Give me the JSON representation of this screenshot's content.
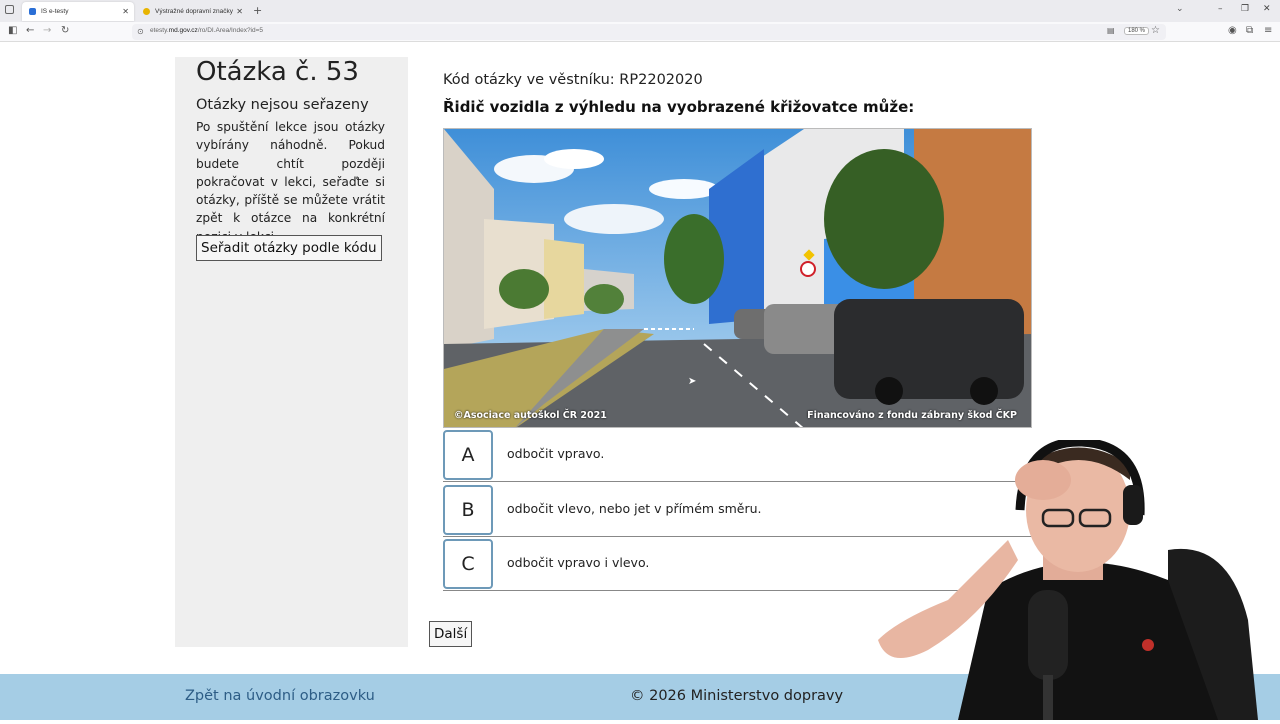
{
  "browser": {
    "tabs": [
      {
        "title": "IS e-testy",
        "active": true
      },
      {
        "title": "Výstražné dopravní značky",
        "active": false
      }
    ],
    "url_prefix": "etesty.",
    "url_domain": "md.gov.cz",
    "url_path": "/ro/DI.Area/Index?id=5",
    "zoom": "180 %"
  },
  "sidebar": {
    "question_number": "Otázka č. 53",
    "heading": "Otázky nejsou seřazeny",
    "paragraph": "Po spuštění lekce jsou otázky vybírány náhodně. Pokud budete chtít později pokračovat v lekci, seřaďte si otázky, příště se můžete vrátit zpět k otázce na konkrétní pozici v lekci.",
    "sort_button": "Seřadit otázky podle kódu"
  },
  "main": {
    "code_line": "Kód otázky ve věstníku: RP2202020",
    "question": "Řidič vozidla z výhledu na vyobrazené křižovatce může:",
    "photo_caption_left": "©Asociace autoškol ČR 2021",
    "photo_caption_right": "Financováno z fondu zábrany škod ČKP",
    "answers": [
      {
        "letter": "A",
        "text": "odbočit vpravo."
      },
      {
        "letter": "B",
        "text": "odbočit vlevo, nebo jet v přímém směru."
      },
      {
        "letter": "C",
        "text": "odbočit vpravo i vlevo."
      }
    ],
    "next_button": "Další"
  },
  "footer": {
    "back_link": "Zpět na úvodní obrazovku",
    "copyright": "© 2026 Ministerstvo dopravy"
  },
  "colors": {
    "footer_bg": "#a5cde5",
    "answer_border": "#6d99b8",
    "link": "#2d5d86",
    "sidebar_bg": "#efefef"
  }
}
